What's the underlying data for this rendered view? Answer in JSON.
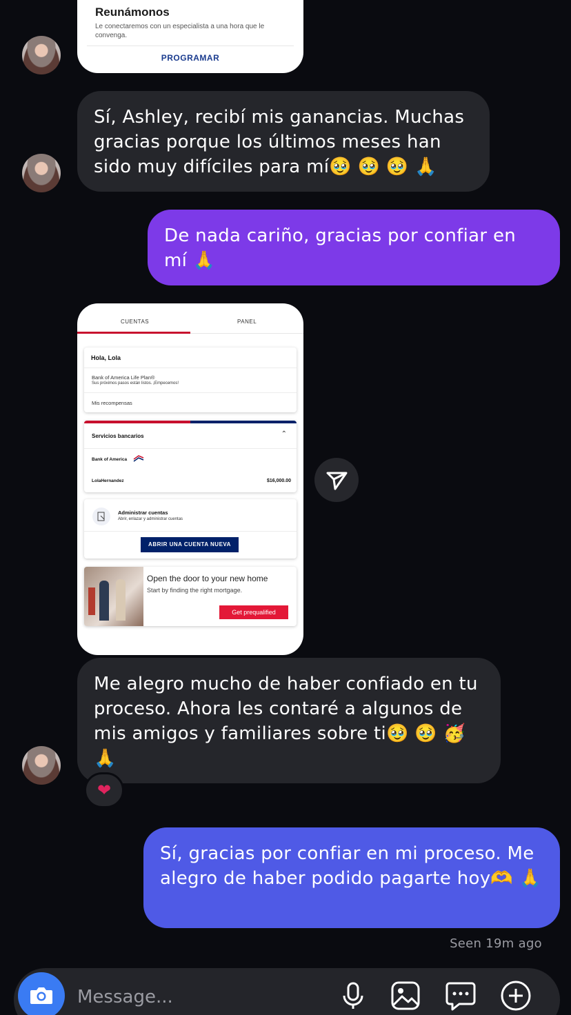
{
  "card_top": {
    "title": "Reunámonos",
    "description": "Le conectaremos con un especialista a una hora que le convenga.",
    "action": "PROGRAMAR"
  },
  "messages": [
    {
      "from": "in",
      "text": "Sí, Ashley, recibí mis ganancias. Muchas gracias porque los últimos meses han sido muy difíciles para mí🥹 🥹 🥹 🙏"
    },
    {
      "from": "out",
      "text": "De nada cariño, gracias por confiar en mí 🙏"
    },
    {
      "from": "in",
      "text": "Me alegro mucho de haber confiado en tu proceso. Ahora les contaré a algunos de mis amigos y familiares sobre ti🥹 🥹 🥳 🙏"
    },
    {
      "from": "out",
      "text": "Sí, gracias por confiar en mi proceso. Me alegro de haber podido pagarte hoy🫶 🙏"
    }
  ],
  "bank_screenshot": {
    "tabs": [
      "CUENTAS",
      "PANEL"
    ],
    "greeting": "Hola, Lola",
    "life_plan_title": "Bank of America Life Plan®",
    "life_plan_sub": "Sus próximos pasos están listos. ¡Empecemos!",
    "rewards": "Mis recompensas",
    "banking_header": "Servicios bancarios",
    "bank_name": "Bank of America",
    "account_name": "LolaHernandez",
    "account_balance": "$16,000.00",
    "manage_title": "Administrar cuentas",
    "manage_sub": "Abrir, enlazar y administrar cuentas",
    "open_account_button": "ABRIR UNA CUENTA NUEVA",
    "promo_title": "Open the door to your new home",
    "promo_sub": "Start by finding the right mortgage.",
    "promo_button": "Get prequalified"
  },
  "reaction": "❤",
  "seen_status": "Seen 19m ago",
  "composer": {
    "placeholder": "Message..."
  },
  "icons": {
    "send": "send-icon",
    "camera": "camera-icon",
    "mic": "microphone-icon",
    "gallery": "gallery-icon",
    "chat": "chat-bubble-icon",
    "add": "plus-icon"
  },
  "colors": {
    "background": "#0a0b10",
    "incoming_bubble": "#25262b",
    "outgoing_purple": "#7d3ae8",
    "outgoing_blue": "#4f5ae6",
    "camera_button": "#3a7bf3",
    "boa_red": "#c8102e",
    "boa_navy": "#012169"
  }
}
